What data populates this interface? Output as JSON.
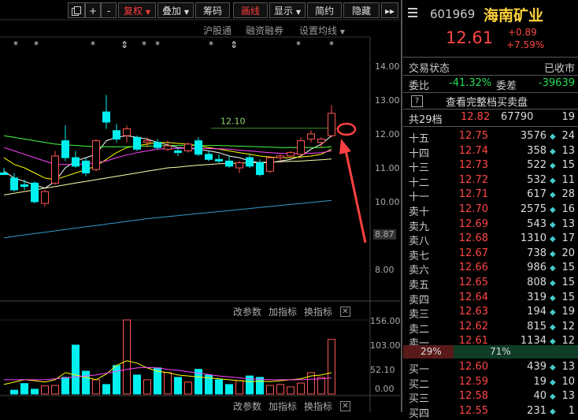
{
  "toolbar": {
    "buttons": [
      "+",
      "-",
      "复权",
      "叠加",
      "筹码",
      "画线",
      "显示",
      "简约",
      "隐藏",
      "▸▸"
    ],
    "sub_labels": [
      "沪股通",
      "融资融券",
      "设置均线"
    ]
  },
  "chart": {
    "price_ticks": [
      "14.00",
      "13.00",
      "12.00",
      "11.00",
      "10.00",
      "8.87",
      "8.00"
    ],
    "annotation": "12.10",
    "volume_ticks": [
      "156.00",
      "103.00",
      "52.10",
      "0.00"
    ],
    "bottom_labels": [
      "改参数",
      "加指标",
      "换指标"
    ],
    "close_glyph": "✕",
    "marker_star": "*",
    "marker_arrow": "⇕",
    "colors": {
      "up": "#ff5555",
      "down": "#00f0f0",
      "ma5": "#ffffff",
      "ma10": "#ffff00",
      "ma20": "#ff44ff",
      "ma30": "#44ff44",
      "ma60": "#ffffaa",
      "ma120": "#3399cc"
    }
  },
  "chart_data": {
    "type": "candlestick",
    "ylim": [
      8.0,
      14.0
    ],
    "candles": [
      {
        "o": 10.85,
        "h": 11.0,
        "l": 10.8,
        "c": 10.8
      },
      {
        "o": 10.7,
        "h": 10.85,
        "l": 10.3,
        "c": 10.35
      },
      {
        "o": 10.5,
        "h": 10.65,
        "l": 10.35,
        "c": 10.45
      },
      {
        "o": 10.55,
        "h": 10.6,
        "l": 9.95,
        "c": 10.0
      },
      {
        "o": 9.95,
        "h": 10.35,
        "l": 9.85,
        "c": 10.3
      },
      {
        "o": 10.55,
        "h": 11.5,
        "l": 10.5,
        "c": 11.35
      },
      {
        "o": 11.8,
        "h": 12.25,
        "l": 11.2,
        "c": 11.3
      },
      {
        "o": 11.3,
        "h": 11.5,
        "l": 11.0,
        "c": 11.05
      },
      {
        "o": 11.2,
        "h": 11.3,
        "l": 10.75,
        "c": 10.85
      },
      {
        "o": 10.95,
        "h": 11.85,
        "l": 10.9,
        "c": 11.8
      },
      {
        "o": 12.65,
        "h": 13.15,
        "l": 12.15,
        "c": 12.35
      },
      {
        "o": 12.1,
        "h": 12.3,
        "l": 11.75,
        "c": 11.85
      },
      {
        "o": 11.95,
        "h": 12.25,
        "l": 11.75,
        "c": 12.15
      },
      {
        "o": 11.9,
        "h": 11.95,
        "l": 11.5,
        "c": 11.55
      },
      {
        "o": 11.75,
        "h": 11.9,
        "l": 11.6,
        "c": 11.8
      },
      {
        "o": 11.75,
        "h": 11.85,
        "l": 11.55,
        "c": 11.6
      },
      {
        "o": 11.55,
        "h": 11.8,
        "l": 11.5,
        "c": 11.65
      },
      {
        "o": 11.5,
        "h": 11.6,
        "l": 11.35,
        "c": 11.45
      },
      {
        "o": 11.5,
        "h": 11.75,
        "l": 11.45,
        "c": 11.7
      },
      {
        "o": 11.8,
        "h": 11.9,
        "l": 11.35,
        "c": 11.4
      },
      {
        "o": 11.4,
        "h": 11.5,
        "l": 11.2,
        "c": 11.25
      },
      {
        "o": 11.25,
        "h": 11.4,
        "l": 11.15,
        "c": 11.2
      },
      {
        "o": 11.2,
        "h": 11.35,
        "l": 11.0,
        "c": 11.05
      },
      {
        "o": 11.0,
        "h": 11.2,
        "l": 10.85,
        "c": 11.15
      },
      {
        "o": 11.3,
        "h": 11.4,
        "l": 11.0,
        "c": 11.05
      },
      {
        "o": 11.15,
        "h": 11.25,
        "l": 10.75,
        "c": 10.8
      },
      {
        "o": 10.9,
        "h": 11.35,
        "l": 10.85,
        "c": 11.3
      },
      {
        "o": 11.3,
        "h": 11.4,
        "l": 11.2,
        "c": 11.35
      },
      {
        "o": 11.35,
        "h": 11.5,
        "l": 11.3,
        "c": 11.45
      },
      {
        "o": 11.4,
        "h": 11.9,
        "l": 11.35,
        "c": 11.8
      },
      {
        "o": 11.85,
        "h": 12.1,
        "l": 11.75,
        "c": 12.0
      },
      {
        "o": 11.75,
        "h": 11.9,
        "l": 11.6,
        "c": 11.85
      },
      {
        "o": 11.95,
        "h": 12.85,
        "l": 11.9,
        "c": 12.61
      }
    ],
    "volumes": [
      0,
      8,
      22,
      10,
      17,
      18,
      35,
      103,
      48,
      30,
      20,
      60,
      156,
      40,
      30,
      55,
      45,
      35,
      25,
      52,
      40,
      30,
      20,
      28,
      38,
      35,
      18,
      20,
      15,
      23,
      45,
      35,
      115
    ],
    "ma_lines": [
      {
        "name": "MA5",
        "values": [
          10.9,
          10.7,
          10.6,
          10.5,
          10.4,
          10.6,
          11.0,
          11.2,
          11.3,
          11.4,
          11.8,
          11.9,
          11.95,
          11.9,
          11.85,
          11.75,
          11.68,
          11.6,
          11.58,
          11.55,
          11.5,
          11.45,
          11.35,
          11.3,
          11.2,
          11.15,
          11.15,
          11.2,
          11.25,
          11.35,
          11.55,
          11.7,
          11.95
        ]
      },
      {
        "name": "MA10",
        "values": [
          11.3,
          11.1,
          11.0,
          10.85,
          10.7,
          10.65,
          10.75,
          10.85,
          10.95,
          11.05,
          11.25,
          11.45,
          11.6,
          11.65,
          11.7,
          11.75,
          11.75,
          11.72,
          11.7,
          11.65,
          11.6,
          11.55,
          11.5,
          11.45,
          11.4,
          11.35,
          11.32,
          11.3,
          11.3,
          11.32,
          11.35,
          11.4,
          11.55
        ]
      },
      {
        "name": "MA20",
        "values": [
          11.6,
          11.5,
          11.4,
          11.3,
          11.2,
          11.1,
          11.1,
          11.1,
          11.12,
          11.15,
          11.2,
          11.3,
          11.38,
          11.45,
          11.5,
          11.55,
          11.57,
          11.58,
          11.58,
          11.58,
          11.57,
          11.56,
          11.55,
          11.52,
          11.5,
          11.47,
          11.45,
          11.43,
          11.42,
          11.42,
          11.43,
          11.45,
          11.5
        ]
      },
      {
        "name": "MA30",
        "values": [
          11.95,
          11.9,
          11.85,
          11.8,
          11.75,
          11.7,
          11.68,
          11.66,
          11.64,
          11.62,
          11.62,
          11.62,
          11.62,
          11.63,
          11.64,
          11.65,
          11.66,
          11.66,
          11.66,
          11.66,
          11.66,
          11.66,
          11.65,
          11.64,
          11.63,
          11.62,
          11.61,
          11.6,
          11.6,
          11.6,
          11.6,
          11.6,
          11.62
        ]
      },
      {
        "name": "MA60",
        "values": [
          10.2,
          10.25,
          10.3,
          10.35,
          10.4,
          10.45,
          10.5,
          10.55,
          10.6,
          10.65,
          10.7,
          10.75,
          10.8,
          10.85,
          10.9,
          10.95,
          11.0,
          11.02,
          11.05,
          11.08,
          11.1,
          11.12,
          11.13,
          11.14,
          11.15,
          11.16,
          11.17,
          11.18,
          11.19,
          11.2,
          11.22,
          11.24,
          11.26
        ]
      },
      {
        "name": "MA120",
        "values": [
          8.93,
          8.98,
          9.02,
          9.06,
          9.1,
          9.14,
          9.18,
          9.22,
          9.26,
          9.3,
          9.34,
          9.38,
          9.42,
          9.46,
          9.5,
          9.53,
          9.56,
          9.59,
          9.62,
          9.65,
          9.68,
          9.71,
          9.74,
          9.77,
          9.8,
          9.83,
          9.86,
          9.89,
          9.92,
          9.95,
          9.98,
          10.01,
          10.04
        ]
      }
    ]
  },
  "quote": {
    "code": "601969",
    "name": "海南矿业",
    "price": "12.61",
    "change": "+0.89",
    "change_pct": "+7.59%",
    "status_label": "交易状态",
    "status_value": "已收市",
    "weibi_label": "委比",
    "weibi_value": "-41.32%",
    "weicha_label": "委差",
    "weicha_value": "-39639",
    "help_glyph": "?",
    "full_book_label": "查看完整档买卖盘",
    "total_label": "共29档",
    "total_price": "12.82",
    "total_vol": "67790",
    "total_count": "19",
    "asks": [
      {
        "label": "十五",
        "price": "12.75",
        "vol": "3576",
        "count": "24"
      },
      {
        "label": "十四",
        "price": "12.74",
        "vol": "358",
        "count": "13"
      },
      {
        "label": "十三",
        "price": "12.73",
        "vol": "522",
        "count": "15"
      },
      {
        "label": "十二",
        "price": "12.72",
        "vol": "532",
        "count": "11"
      },
      {
        "label": "十一",
        "price": "12.71",
        "vol": "617",
        "count": "28"
      },
      {
        "label": "卖十",
        "price": "12.70",
        "vol": "2575",
        "count": "16"
      },
      {
        "label": "卖九",
        "price": "12.69",
        "vol": "543",
        "count": "13"
      },
      {
        "label": "卖八",
        "price": "12.68",
        "vol": "1310",
        "count": "17"
      },
      {
        "label": "卖七",
        "price": "12.67",
        "vol": "738",
        "count": "20"
      },
      {
        "label": "卖六",
        "price": "12.66",
        "vol": "986",
        "count": "15"
      },
      {
        "label": "卖五",
        "price": "12.65",
        "vol": "808",
        "count": "15"
      },
      {
        "label": "卖四",
        "price": "12.64",
        "vol": "319",
        "count": "15"
      },
      {
        "label": "卖三",
        "price": "12.63",
        "vol": "194",
        "count": "19"
      },
      {
        "label": "卖二",
        "price": "12.62",
        "vol": "815",
        "count": "12"
      },
      {
        "label": "卖一",
        "price": "12.61",
        "vol": "1134",
        "count": "12"
      }
    ],
    "ratio_sell": "29%",
    "ratio_buy": "71%",
    "ratio_sell_frac": 0.29,
    "bids": [
      {
        "label": "买一",
        "price": "12.60",
        "vol": "439",
        "count": "13"
      },
      {
        "label": "买二",
        "price": "12.59",
        "vol": "19",
        "count": "10"
      },
      {
        "label": "买三",
        "price": "12.58",
        "vol": "40",
        "count": "13"
      },
      {
        "label": "买四",
        "price": "12.55",
        "vol": "231",
        "count": "1"
      }
    ],
    "diamond": "◆"
  }
}
